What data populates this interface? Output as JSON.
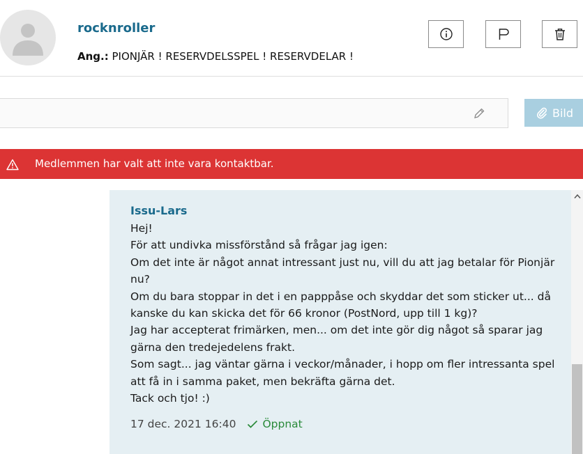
{
  "header": {
    "username": "rocknroller",
    "subject_label": "Ang.:",
    "subject_text": "PIONJÄR ! RESERVDELSSPEL ! RESERVDELAR !",
    "buttons": [
      {
        "name": "info-button",
        "icon": "info-icon"
      },
      {
        "name": "flag-button",
        "icon": "flag-icon"
      },
      {
        "name": "delete-button",
        "icon": "trash-icon"
      }
    ]
  },
  "composer": {
    "input_value": "",
    "input_placeholder": "",
    "attach_label": "Bild",
    "attach_icon": "paperclip-icon",
    "edit_icon": "pencil-icon"
  },
  "alert": {
    "icon": "warning-icon",
    "text": "Medlemmen har valt att inte vara kontaktbar.",
    "color": "#dc3434"
  },
  "message": {
    "sender": "Issu-Lars",
    "lines": [
      "Hej!",
      "För att undivka missförstånd så frågar jag igen:",
      "Om det inte är något annat intressant just nu, vill du att jag betalar för Pionjär",
      "nu?",
      "Om du bara stoppar in det i en papppåse och skyddar det som sticker ut... då",
      "kanske du kan skicka det för 66 kronor (PostNord, upp till 1 kg)?",
      "Jag har accepterat frimärken, men... om det inte gör dig något så sparar jag",
      "gärna den tredejedelens frakt.",
      "Som sagt... jag väntar gärna i veckor/månader, i hopp om fler intressanta spel",
      "att få in i samma paket, men bekräfta gärna det.",
      "Tack och tjo! :)"
    ],
    "timestamp": "17 dec. 2021 16:40",
    "status": "Öppnat",
    "status_icon": "checkmark-icon"
  },
  "colors": {
    "accent": "#1a6a8c",
    "bubble": "#e5eff3",
    "status": "#2a8a3a",
    "attach_button": "#a9cfe0"
  }
}
